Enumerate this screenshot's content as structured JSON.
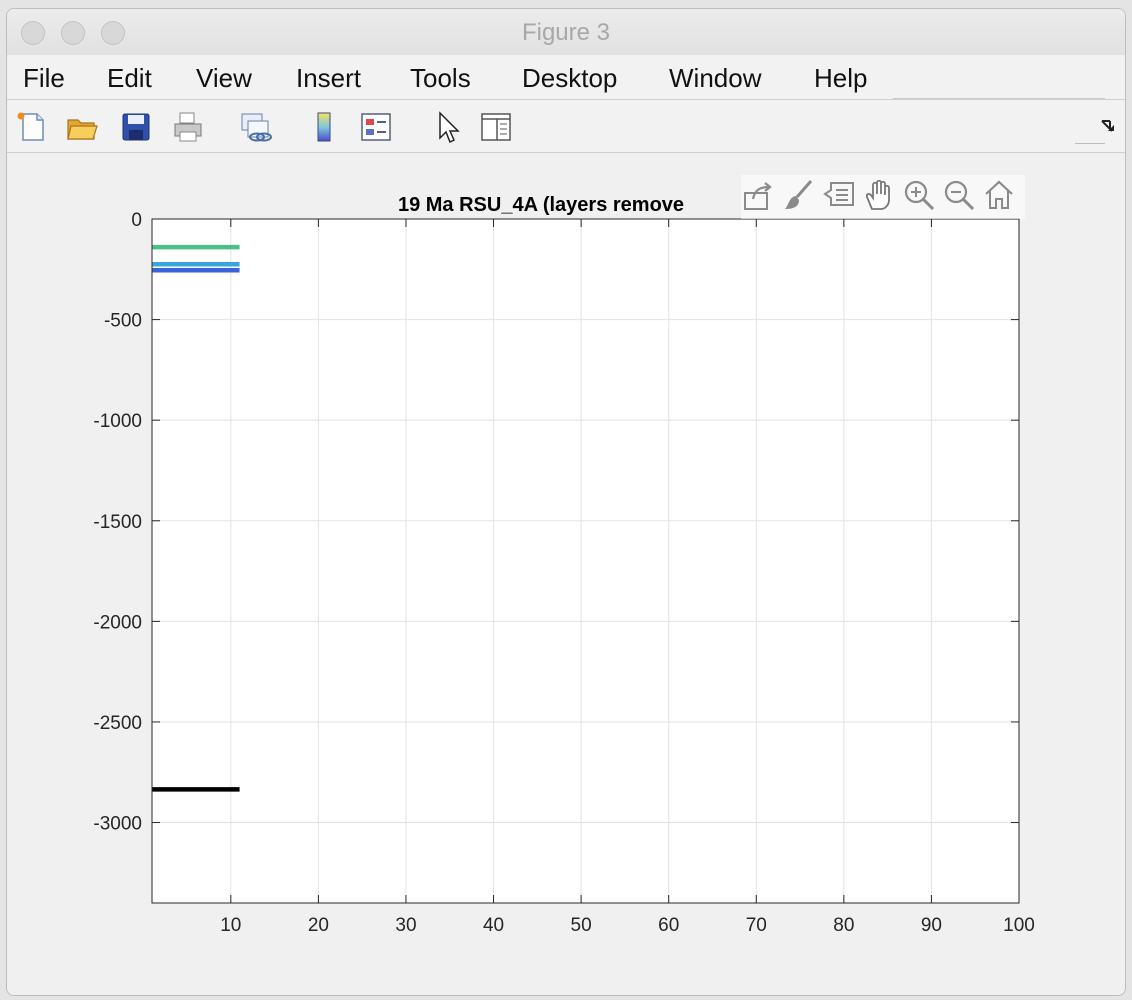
{
  "window": {
    "title": "Figure 3"
  },
  "menu": [
    "File",
    "Edit",
    "View",
    "Insert",
    "Tools",
    "Desktop",
    "Window",
    "Help"
  ],
  "toolbar": {
    "icons": [
      "new-figure-icon",
      "open-file-icon",
      "save-icon",
      "print-icon",
      "link-plot-icon",
      "insert-colorbar-icon",
      "insert-legend-icon",
      "edit-plot-pointer-icon",
      "property-inspector-icon"
    ],
    "dock": "dock-arrow-icon"
  },
  "axes_toolbar": [
    "export-icon",
    "brush-icon",
    "data-tips-icon",
    "pan-hand-icon",
    "zoom-in-icon",
    "zoom-out-icon",
    "home-icon"
  ],
  "chart_data": {
    "type": "line",
    "title": "19 Ma   RSU_4A      (layers remove",
    "xlabel": "",
    "ylabel": "",
    "xlim": [
      1,
      100
    ],
    "ylim": [
      -3400,
      0
    ],
    "xticks": [
      10,
      20,
      30,
      40,
      50,
      60,
      70,
      80,
      90,
      100
    ],
    "yticks": [
      0,
      -500,
      -1000,
      -1500,
      -2000,
      -2500,
      -3000
    ],
    "xtick_labels": [
      "10",
      "20",
      "30",
      "40",
      "50",
      "60",
      "70",
      "80",
      "90",
      "100"
    ],
    "ytick_labels": [
      "0",
      "-500",
      "-1000",
      "-1500",
      "-2000",
      "-2500",
      "-3000"
    ],
    "grid": true,
    "series": [
      {
        "x": [
          1,
          11
        ],
        "y": [
          -140,
          -140
        ],
        "color": "#4dbe86"
      },
      {
        "x": [
          1,
          11
        ],
        "y": [
          -225,
          -225
        ],
        "color": "#35a8d8"
      },
      {
        "x": [
          1,
          11
        ],
        "y": [
          -255,
          -255
        ],
        "color": "#3a63d9"
      },
      {
        "x": [
          1,
          11
        ],
        "y": [
          -2835,
          -2835
        ],
        "color": "#000000"
      }
    ]
  }
}
